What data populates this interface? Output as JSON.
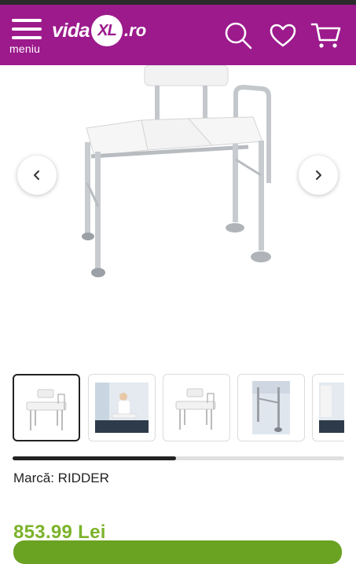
{
  "header": {
    "menu_label": "meniu",
    "logo_text_left": "vida",
    "logo_text_badge": "XL",
    "logo_text_right": ".ro",
    "brand_color": "#9c1a8c",
    "icons": [
      "menu-icon",
      "search-icon",
      "heart-icon",
      "cart-icon"
    ]
  },
  "gallery": {
    "prev_icon": "chevron-left-icon",
    "next_icon": "chevron-right-icon",
    "thumbnail_count_visible": 5,
    "active_thumbnail_index": 0,
    "scroll_progress": 0.49
  },
  "product": {
    "brand_label": "Marcă: RIDDER",
    "price": "853.99 Lei",
    "price_color": "#7bb32a",
    "cta_color": "#6aa221"
  }
}
